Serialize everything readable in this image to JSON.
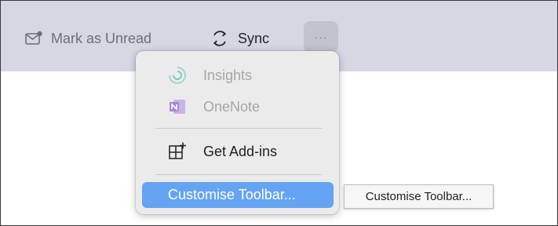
{
  "toolbar": {
    "mark_unread": {
      "label": "Mark as Unread",
      "icon": "envelope-unread-icon"
    },
    "sync": {
      "label": "Sync",
      "icon": "sync-icon"
    },
    "more": {
      "label": "···",
      "icon": "more-icon"
    }
  },
  "menu": {
    "items": [
      {
        "label": "Insights",
        "icon": "insights-icon",
        "enabled": false
      },
      {
        "label": "OneNote",
        "icon": "onenote-icon",
        "enabled": false
      },
      {
        "label": "Get Add-ins",
        "icon": "add-ins-icon",
        "enabled": true
      },
      {
        "label": "Customise Toolbar...",
        "highlighted": true
      }
    ]
  },
  "tooltip": {
    "text": "Customise Toolbar..."
  },
  "colors": {
    "toolbar_bg": "#d5d7e3",
    "highlight": "#64a4f2",
    "menu_bg": "#ebebeb",
    "onenote_purple": "#a985d6",
    "insights_teal": "#7fcbc0"
  }
}
